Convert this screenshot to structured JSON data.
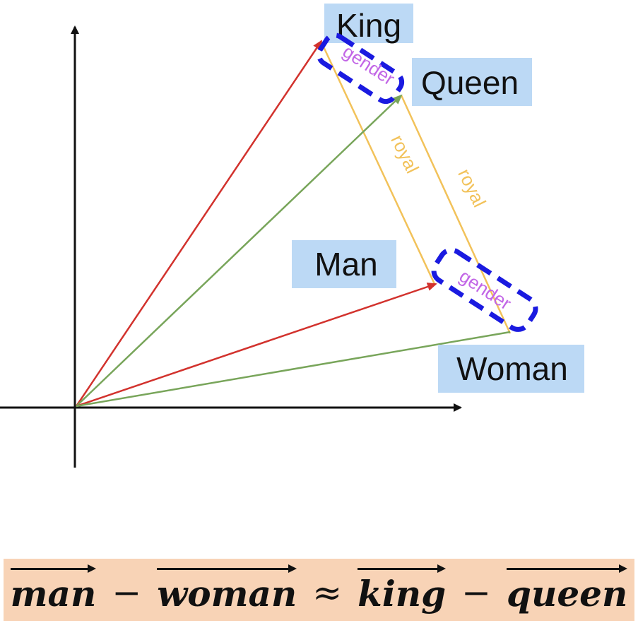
{
  "words": {
    "king": "King",
    "queen": "Queen",
    "man": "Man",
    "woman": "Woman"
  },
  "relations": {
    "gender": "gender",
    "royal": "royal"
  },
  "equation": {
    "term1": "man",
    "op1": "−",
    "term2": "woman",
    "op2": "≈",
    "term3": "king",
    "op3": "−",
    "term4": "queen"
  },
  "colors": {
    "king_man_vector": "#d2322d",
    "queen_woman_vector": "#78a55a",
    "royal_relation": "#f2c25a",
    "gender_text": "#c266e6",
    "gender_box": "#1a1ae0",
    "label_bg": "#bcd9f5",
    "equation_bg": "#f8d3b6"
  }
}
